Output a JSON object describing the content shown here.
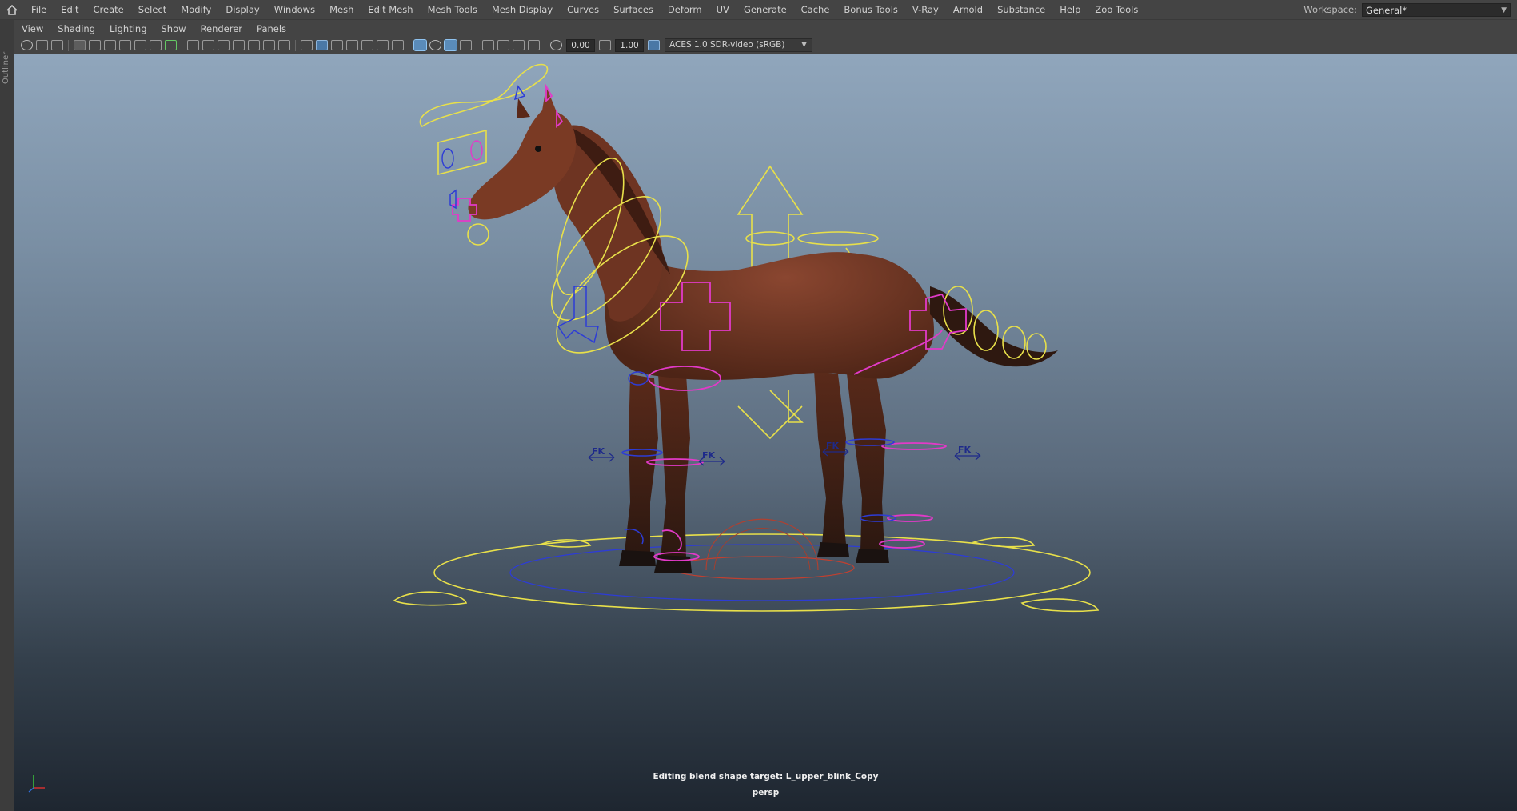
{
  "main_menu": [
    "File",
    "Edit",
    "Create",
    "Select",
    "Modify",
    "Display",
    "Windows",
    "Mesh",
    "Edit Mesh",
    "Mesh Tools",
    "Mesh Display",
    "Curves",
    "Surfaces",
    "Deform",
    "UV",
    "Generate",
    "Cache",
    "Bonus Tools",
    "V-Ray",
    "Arnold",
    "Substance",
    "Help",
    "Zoo Tools"
  ],
  "workspace": {
    "label": "Workspace:",
    "value": "General*"
  },
  "outliner_label": "Outliner",
  "panel_menu": [
    "View",
    "Shading",
    "Lighting",
    "Show",
    "Renderer",
    "Panels"
  ],
  "toolbar": {
    "exposure": "0.00",
    "gamma": "1.00",
    "color_management": "ACES 1.0 SDR-video (sRGB)"
  },
  "viewport": {
    "camera": "persp",
    "status": "Editing blend shape target: L_upper_blink_Copy",
    "fk_label": "FK"
  },
  "colors": {
    "accent_yellow": "#e8e04a",
    "accent_magenta": "#e23ac8",
    "accent_blue": "#2d3cd6",
    "horse": "#6b3220"
  }
}
